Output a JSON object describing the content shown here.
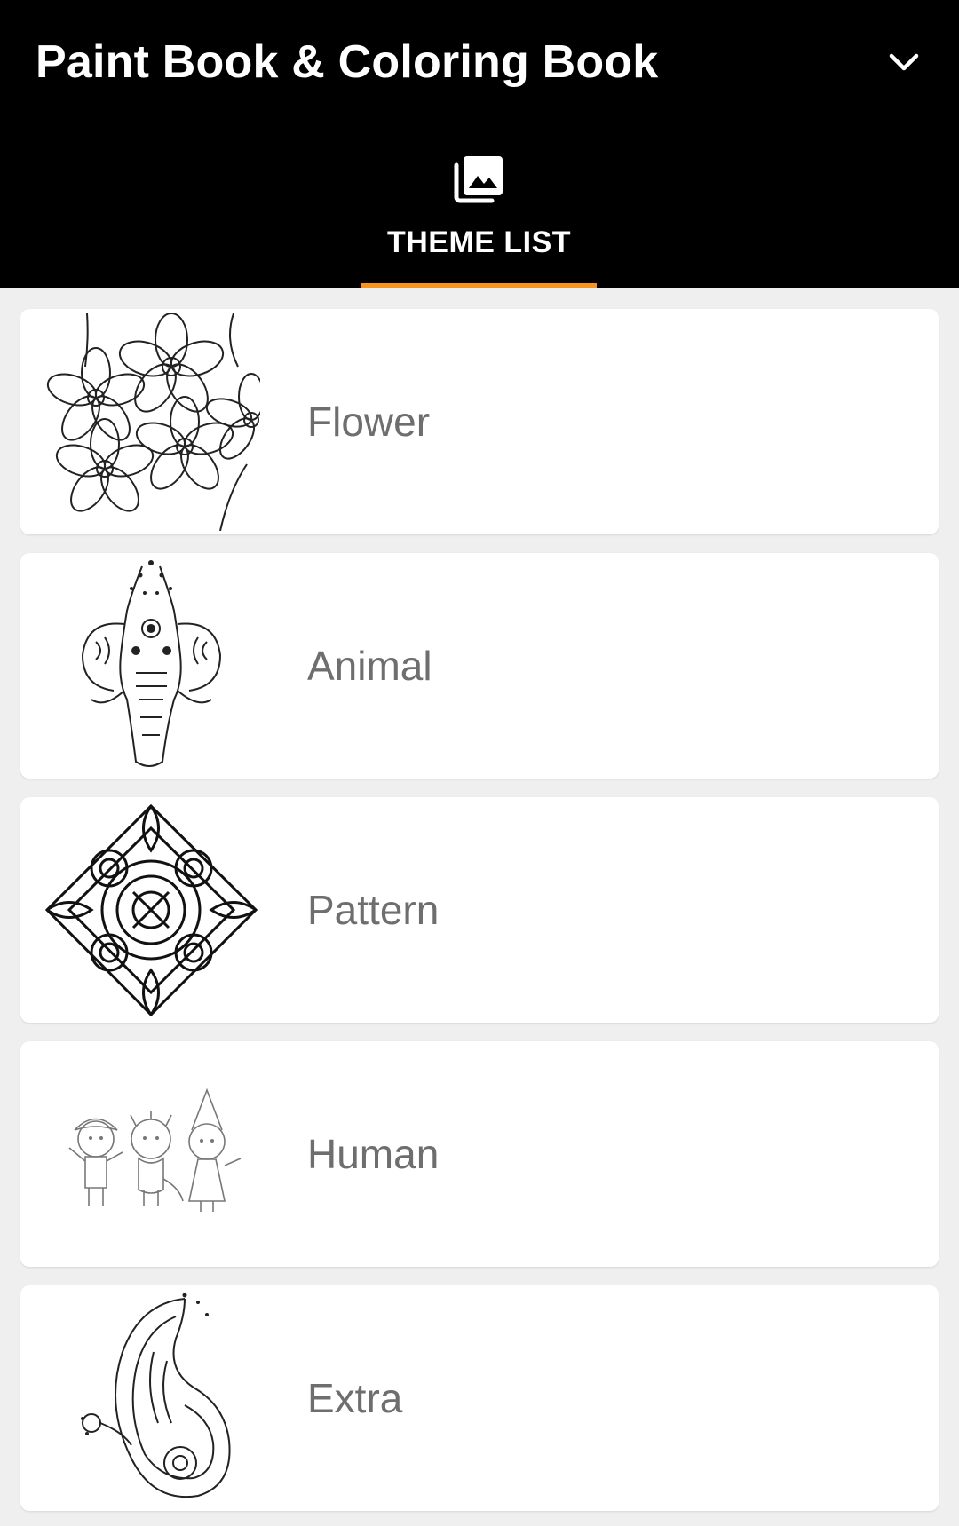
{
  "app_bar": {
    "title": "Paint Book & Coloring Book",
    "dropdown_icon": "chevron-down-icon",
    "background_color": "#000000"
  },
  "tabs": [
    {
      "label": "THEME LIST",
      "icon": "photo-library-icon",
      "selected": true,
      "indicator_color": "#f7941d"
    }
  ],
  "themes": [
    {
      "label": "Flower",
      "thumbnail": "flower-line-art"
    },
    {
      "label": "Animal",
      "thumbnail": "elephant-line-art"
    },
    {
      "label": "Pattern",
      "thumbnail": "mandala-pattern-line-art"
    },
    {
      "label": "Human",
      "thumbnail": "kids-line-art"
    },
    {
      "label": "Extra",
      "thumbnail": "paisley-line-art"
    }
  ]
}
